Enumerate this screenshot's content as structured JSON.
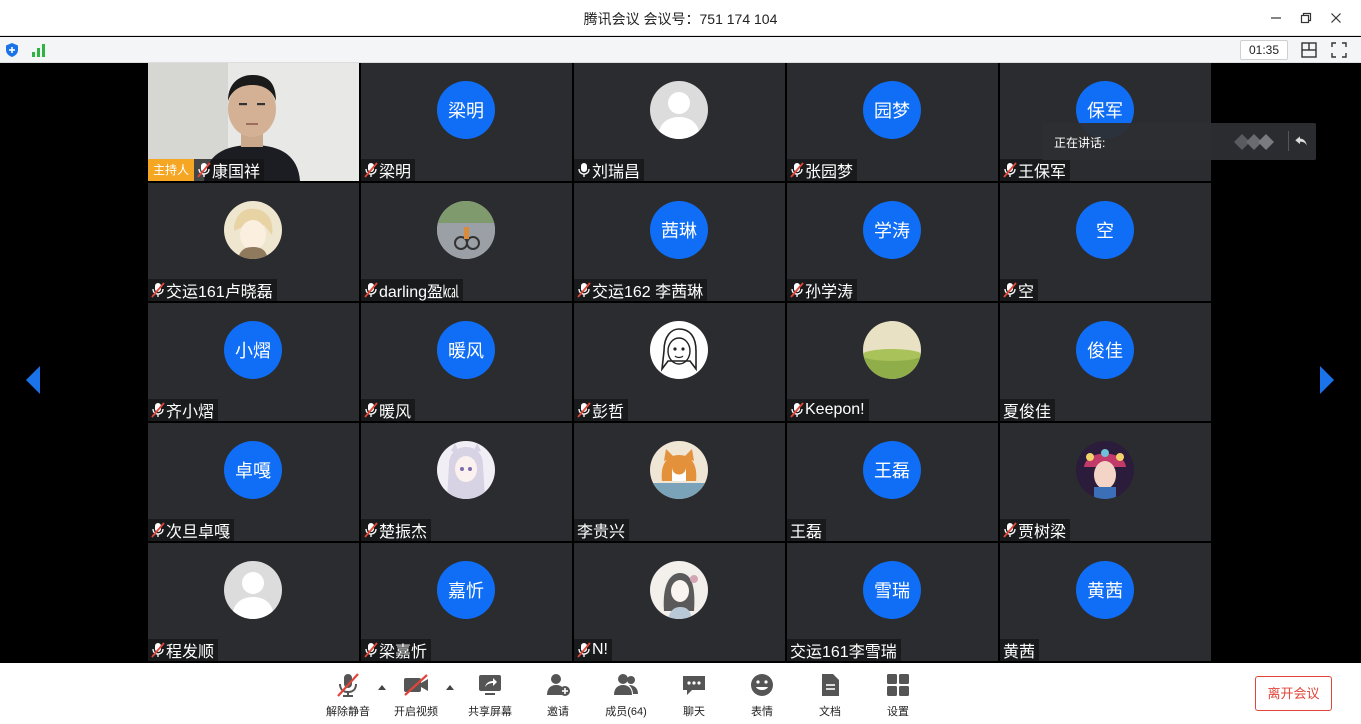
{
  "window": {
    "title": "腾讯会议 会议号：751 174 104"
  },
  "status": {
    "timer": "01:35"
  },
  "speaking": {
    "label": "正在讲话:"
  },
  "host_badge": "主持人",
  "participants": [
    {
      "name": "康国祥",
      "mic": true,
      "kind": "video",
      "host": true
    },
    {
      "name": "梁明",
      "mic": true,
      "kind": "initials",
      "initials": "梁明"
    },
    {
      "name": "刘瑞昌",
      "mic": true,
      "mic_on": true,
      "kind": "default"
    },
    {
      "name": "张园梦",
      "mic": true,
      "kind": "initials",
      "initials": "园梦"
    },
    {
      "name": "王保军",
      "mic": true,
      "kind": "initials",
      "initials": "保军"
    },
    {
      "name": "交运161卢晓磊",
      "mic": true,
      "kind": "photo",
      "avatar": "anime-boy"
    },
    {
      "name": "darling盈㎉",
      "mic": true,
      "kind": "photo",
      "avatar": "bike-street"
    },
    {
      "name": "交运162 李茜琳",
      "mic": true,
      "kind": "initials",
      "initials": "茜琳"
    },
    {
      "name": "孙学涛",
      "mic": true,
      "kind": "initials",
      "initials": "学涛"
    },
    {
      "name": "空",
      "mic": true,
      "kind": "initials",
      "initials": "空"
    },
    {
      "name": "齐小熠",
      "mic": true,
      "kind": "initials",
      "initials": "小熠"
    },
    {
      "name": "暖风",
      "mic": true,
      "kind": "initials",
      "initials": "暖风"
    },
    {
      "name": "彭哲",
      "mic": true,
      "kind": "photo",
      "avatar": "sketch-face"
    },
    {
      "name": "Keepon!",
      "mic": true,
      "kind": "photo",
      "avatar": "field"
    },
    {
      "name": "夏俊佳",
      "mic": false,
      "kind": "initials",
      "initials": "俊佳"
    },
    {
      "name": "次旦卓嘎",
      "mic": true,
      "kind": "initials",
      "initials": "卓嘎"
    },
    {
      "name": "楚振杰",
      "mic": true,
      "kind": "photo",
      "avatar": "anime-girl"
    },
    {
      "name": "李贵兴",
      "mic": false,
      "kind": "photo",
      "avatar": "cat"
    },
    {
      "name": "王磊",
      "mic": false,
      "kind": "initials",
      "initials": "王磊"
    },
    {
      "name": "贾树梁",
      "mic": true,
      "kind": "photo",
      "avatar": "opera"
    },
    {
      "name": "程发顺",
      "mic": true,
      "kind": "default"
    },
    {
      "name": "梁嘉忻",
      "mic": true,
      "kind": "initials",
      "initials": "嘉忻"
    },
    {
      "name": "N!",
      "mic": true,
      "kind": "photo",
      "avatar": "drawing-girl"
    },
    {
      "name": "交运161李雪瑞",
      "mic": false,
      "kind": "initials",
      "initials": "雪瑞"
    },
    {
      "name": "黄茜",
      "mic": false,
      "kind": "initials",
      "initials": "黄茜"
    }
  ],
  "toolbar": {
    "unmute": "解除静音",
    "video": "开启视频",
    "share": "共享屏幕",
    "invite": "邀请",
    "members": "成员(64)",
    "chat": "聊天",
    "emoji": "表情",
    "docs": "文档",
    "settings": "设置",
    "leave": "离开会议"
  },
  "colors": {
    "accent": "#0f6ef5",
    "tile_bg": "#2b2c2f",
    "host_badge": "#f5a623",
    "mute_red": "#e0453a",
    "leave": "#e0453a"
  },
  "icons": {
    "nav_prev": "chevron-left-icon",
    "nav_next": "chevron-right-icon",
    "mic_muted": "mic-muted-icon"
  }
}
